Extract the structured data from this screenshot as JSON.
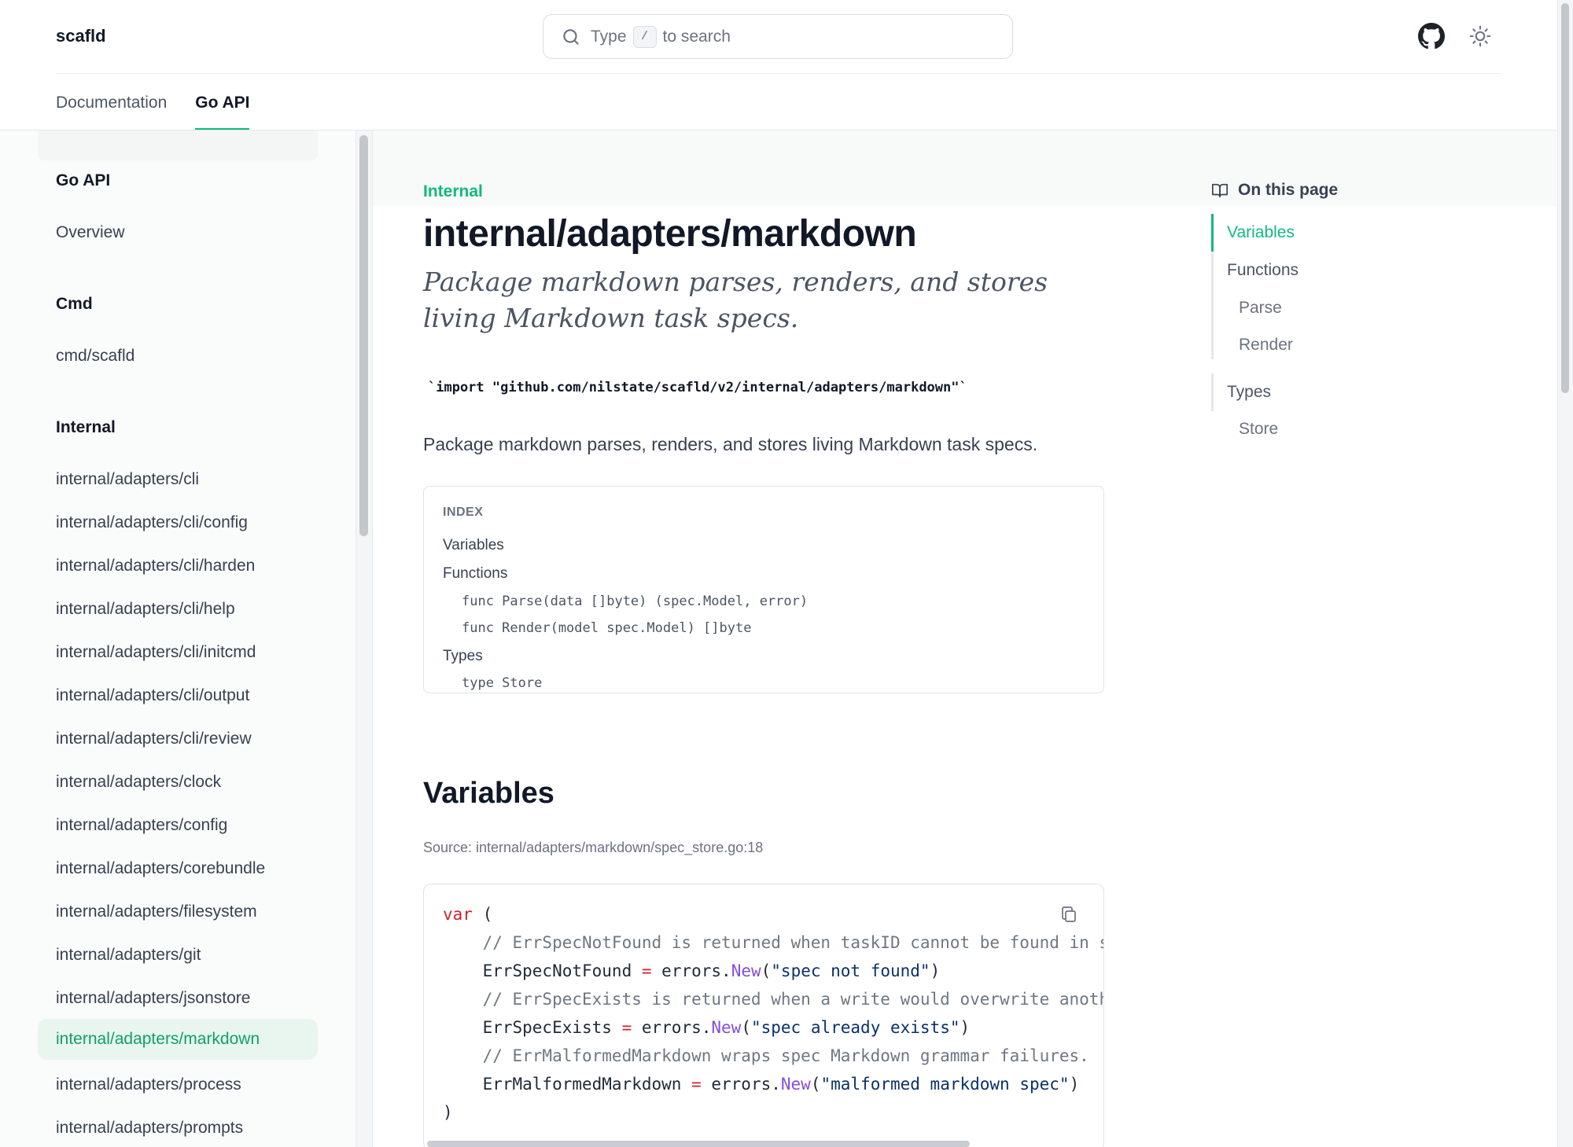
{
  "header": {
    "brand": "scafld",
    "search": {
      "prefix": "Type",
      "shortcut": "/",
      "suffix": "to search"
    },
    "icons": [
      "github-icon",
      "sun-icon",
      "search-icon"
    ]
  },
  "nav": {
    "tabs": [
      {
        "label": "Documentation",
        "active": false
      },
      {
        "label": "Go API",
        "active": true
      }
    ]
  },
  "sidebar": {
    "groups": [
      {
        "heading": "Go API",
        "items": [
          "Overview"
        ]
      },
      {
        "heading": "Cmd",
        "items": [
          "cmd/scafld"
        ]
      },
      {
        "heading": "Internal",
        "items": [
          "internal/adapters/cli",
          "internal/adapters/cli/config",
          "internal/adapters/cli/harden",
          "internal/adapters/cli/help",
          "internal/adapters/cli/initcmd",
          "internal/adapters/cli/output",
          "internal/adapters/cli/review",
          "internal/adapters/clock",
          "internal/adapters/config",
          "internal/adapters/corebundle",
          "internal/adapters/filesystem",
          "internal/adapters/git",
          "internal/adapters/jsonstore",
          "internal/adapters/markdown",
          "internal/adapters/process",
          "internal/adapters/prompts"
        ]
      }
    ],
    "active_item": "internal/adapters/markdown"
  },
  "main": {
    "eyebrow": "Internal",
    "title": "internal/adapters/markdown",
    "lead": "Package markdown parses, renders, and stores living Markdown task specs.",
    "import_line": "`import \"github.com/nilstate/scafld/v2/internal/adapters/markdown\"`",
    "description": "Package markdown parses, renders, and stores living Markdown task specs.",
    "index": {
      "label": "INDEX",
      "variables": "Variables",
      "functions": "Functions",
      "func_parse": "func Parse(data []byte) (spec.Model, error)",
      "func_render": "func Render(model spec.Model) []byte",
      "types": "Types",
      "type_store": "type Store"
    },
    "variables_heading": "Variables",
    "source": "Source: internal/adapters/markdown/spec_store.go:18",
    "code": {
      "var_kw": "var",
      "open": " (",
      "c1": "    // ErrSpecNotFound is returned when taskID cannot be found in s",
      "n1": "    ErrSpecNotFound ",
      "s1": "\"spec not found\"",
      "c2": "    // ErrSpecExists is returned when a write would overwrite anoth",
      "n2": "    ErrSpecExists ",
      "s2": "\"spec already exists\"",
      "c3": "    // ErrMalformedMarkdown wraps spec Markdown grammar failures.",
      "n3": "    ErrMalformedMarkdown ",
      "s3": "\"malformed markdown spec\"",
      "eq": "=",
      "pkg": " errors.",
      "fn": "New",
      "lp": "(",
      "rp": ")",
      "close": ")"
    }
  },
  "toc": {
    "title": "On this page",
    "items": [
      {
        "label": "Variables",
        "active": true
      },
      {
        "label": "Functions",
        "active": false,
        "children": [
          "Parse",
          "Render"
        ]
      },
      {
        "label": "Types",
        "active": false,
        "children": [
          "Store"
        ]
      }
    ]
  }
}
